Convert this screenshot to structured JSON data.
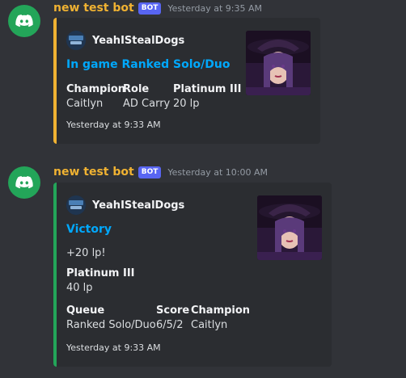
{
  "colors": {
    "background": "#313338",
    "embed_bg": "#2b2d31",
    "username": "#f0b232",
    "bot_badge": "#5865f2",
    "link_title": "#00a8fc",
    "embed1_border": "#f0b232",
    "embed2_border": "#23a559",
    "avatar_bg": "#23a559"
  },
  "messages": [
    {
      "avatar_icon": "discord-logo-icon",
      "username": "new test bot",
      "badge": "BOT",
      "timestamp": "Yesterday at 9:35 AM",
      "embed": {
        "author": "YeahIStealDogs",
        "author_icon": "summoner-icon",
        "title": "In game Ranked Solo/Duo",
        "thumbnail": "champion-portrait",
        "fields": [
          {
            "name": "Champion",
            "value": "Caitlyn"
          },
          {
            "name": "Role",
            "value": "AD Carry"
          },
          {
            "name": "Platinum III",
            "value": "20 lp"
          }
        ],
        "footer": "Yesterday at 9:33 AM"
      }
    },
    {
      "avatar_icon": "discord-logo-icon",
      "username": "new test bot",
      "badge": "BOT",
      "timestamp": "Yesterday at 10:00 AM",
      "embed": {
        "author": "YeahIStealDogs",
        "author_icon": "summoner-icon",
        "title": "Victory",
        "description": "+20 lp!",
        "thumbnail": "champion-portrait",
        "rank_field": {
          "name": "Platinum III",
          "value": "40 lp"
        },
        "fields": [
          {
            "name": "Queue",
            "value": "Ranked Solo/Duo"
          },
          {
            "name": "Score",
            "value": "6/5/2"
          },
          {
            "name": "Champion",
            "value": "Caitlyn"
          }
        ],
        "footer": "Yesterday at 9:33 AM"
      }
    }
  ]
}
